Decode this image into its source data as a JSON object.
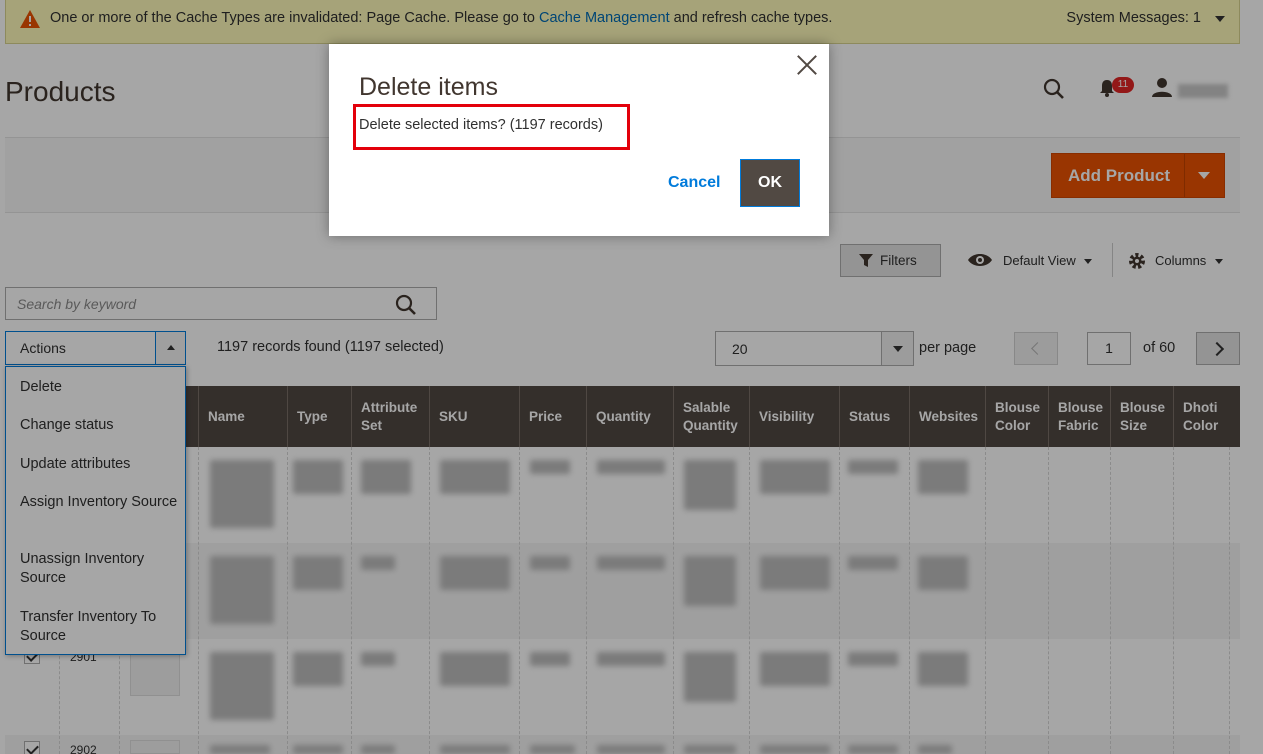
{
  "system_message": {
    "text": "One or more of the Cache Types are invalidated: Page Cache. Please go to",
    "link": "Cache Management",
    "suffix": "and refresh cache types.",
    "right": "System Messages: 1"
  },
  "header": {
    "title": "Products",
    "notifications_count": "11",
    "add_product_label": "Add Product"
  },
  "toolbar": {
    "filters_label": "Filters",
    "view_label": "Default View",
    "columns_label": "Columns",
    "search_placeholder": "Search by keyword",
    "actions_label": "Actions",
    "records_text": "1197 records found (1197 selected)",
    "per_page_value": "20",
    "per_page_label": "per page",
    "page_current": "1",
    "page_total": "of 60"
  },
  "actions_menu": [
    "Delete",
    "Change status",
    "Update attributes",
    "Assign Inventory Source",
    "Unassign Inventory Source",
    "Transfer Inventory To Source"
  ],
  "table": {
    "columns": [
      "Name",
      "Type",
      "Attribute Set",
      "SKU",
      "Price",
      "Quantity",
      "Salable Quantity",
      "Visibility",
      "Status",
      "Websites",
      "Blouse Color",
      "Blouse Fabric",
      "Blouse Size",
      "Dhoti Color"
    ],
    "visible_ids": [
      "2901",
      "2902"
    ]
  },
  "modal": {
    "title": "Delete items",
    "message": "Delete selected items? (1197 records)",
    "cancel_label": "Cancel",
    "ok_label": "OK"
  },
  "colors": {
    "accent": "#eb5202",
    "link": "#007bdb",
    "header_bg": "#514943",
    "highlight": "#e3000b"
  }
}
